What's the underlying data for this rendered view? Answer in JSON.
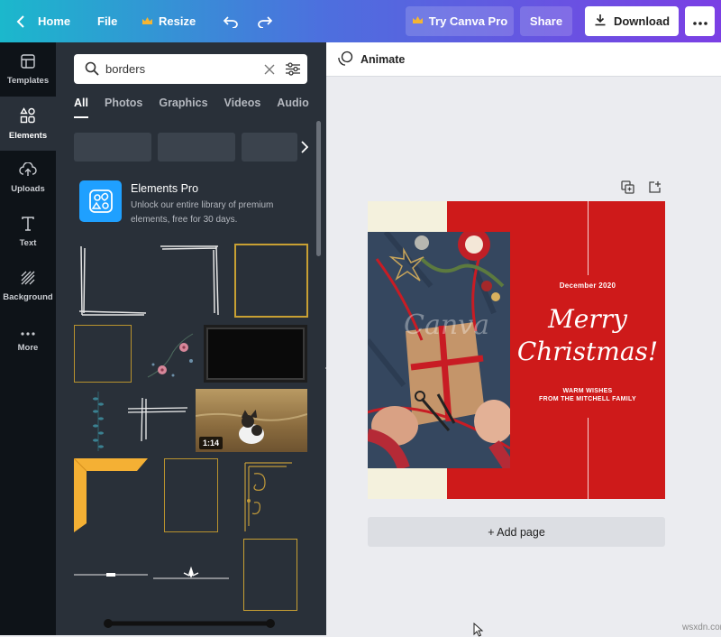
{
  "topbar": {
    "home_label": "Home",
    "file_label": "File",
    "resize_label": "Resize",
    "try_pro_label": "Try Canva Pro",
    "share_label": "Share",
    "download_label": "Download",
    "gradient_colors": [
      "#1bb8cc",
      "#4d6fde",
      "#7b3fe4"
    ]
  },
  "rail": {
    "items": [
      {
        "label": "Templates",
        "icon": "templates-icon"
      },
      {
        "label": "Elements",
        "icon": "elements-icon",
        "active": true
      },
      {
        "label": "Uploads",
        "icon": "upload-cloud-icon"
      },
      {
        "label": "Text",
        "icon": "text-icon"
      },
      {
        "label": "Background",
        "icon": "background-icon"
      },
      {
        "label": "More",
        "icon": "more-dots-icon"
      }
    ]
  },
  "panel": {
    "search_value": "borders",
    "tabs": [
      "All",
      "Photos",
      "Graphics",
      "Videos",
      "Audio"
    ],
    "active_tab": "All",
    "promo": {
      "title": "Elements Pro",
      "description": "Unlock our entire library of premium elements, free for 30 days."
    },
    "video_duration": "1:14"
  },
  "canvas": {
    "animate_label": "Animate",
    "add_page_label": "+ Add page",
    "design": {
      "date": "December 2020",
      "script_line1": "Merry",
      "script_line2": "Christmas!",
      "sub_line1": "WARM WISHES",
      "sub_line2": "FROM THE MITCHELL FAMILY",
      "watermark": "Canva",
      "colors": {
        "red": "#ce1a1a",
        "cream": "#f4f1dd"
      }
    }
  },
  "watermark_site": "wsxdn.com"
}
